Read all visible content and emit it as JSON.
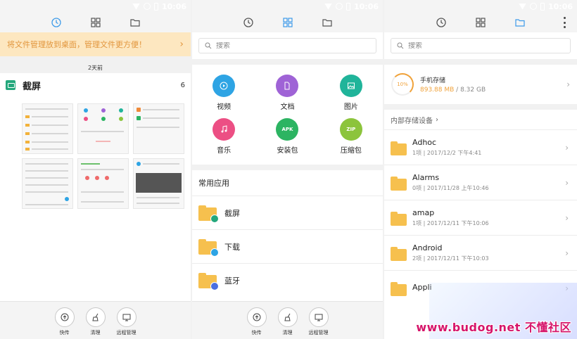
{
  "status": {
    "time": "10:06"
  },
  "left": {
    "banner": "将文件管理放到桌面，管理文件更方便！",
    "date": "2天前",
    "group_title": "截屏",
    "group_count": "6",
    "bottom": [
      "快传",
      "清理",
      "远程管理"
    ]
  },
  "middle": {
    "search_placeholder": "搜索",
    "categories": [
      {
        "label": "视频",
        "color": "#2ea4e4",
        "icon": "play-icon"
      },
      {
        "label": "文档",
        "color": "#9f63d6",
        "icon": "document-icon"
      },
      {
        "label": "图片",
        "color": "#20b49a",
        "icon": "image-icon"
      },
      {
        "label": "音乐",
        "color": "#ec4f84",
        "icon": "music-icon"
      },
      {
        "label": "安装包",
        "color": "#2cb462",
        "icon": "apk-icon",
        "icon_text": "APK"
      },
      {
        "label": "压缩包",
        "color": "#8cc43c",
        "icon": "zip-icon",
        "icon_text": "ZIP"
      }
    ],
    "section": "常用应用",
    "apps": [
      {
        "label": "截屏",
        "badge_color": "#23a77c"
      },
      {
        "label": "下载",
        "badge_color": "#2ea4e4"
      },
      {
        "label": "蓝牙",
        "badge_color": "#4b6fe0"
      }
    ],
    "bottom": [
      "快传",
      "清理",
      "远程管理"
    ]
  },
  "right": {
    "search_placeholder": "搜索",
    "storage": {
      "name": "手机存储",
      "percent": "10%",
      "used": "893.88 MB",
      "total": "/ 8.32 GB"
    },
    "device_title": "内部存储设备",
    "folders": [
      {
        "name": "Adhoc",
        "meta": "1项 | 2017/12/2 下午4:41"
      },
      {
        "name": "Alarms",
        "meta": "0项 | 2017/11/28 上午10:46"
      },
      {
        "name": "amap",
        "meta": "1项 | 2017/12/11 下午10:06"
      },
      {
        "name": "Android",
        "meta": "2项 | 2017/12/11 下午10:03"
      },
      {
        "name": "Appli",
        "meta": ""
      }
    ],
    "watermark": "www.budog.net 不懂社区"
  }
}
